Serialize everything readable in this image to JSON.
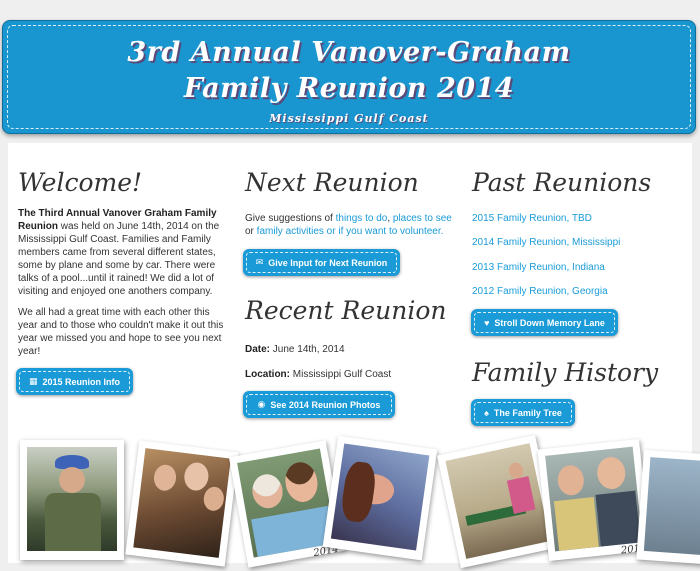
{
  "header": {
    "title_line1": "3rd Annual Vanover-Graham",
    "title_line2": "Family Reunion 2014",
    "subtitle": "Mississippi Gulf Coast"
  },
  "welcome": {
    "heading": "Welcome!",
    "bold_lead": "The Third Annual Vanover Graham Family Reunion",
    "paragraph1_rest": " was held on June 14th, 2014 on the Mississippi Gulf Coast. Families and Family members came from several different states, some by plane and some by car. There were talks of a pool...until it rained! We did a lot of visiting and enjoyed one anothers company.",
    "paragraph2": "We all had a great time with each other this year and to those who couldn't make it out this year we missed you and hope to see you next year!",
    "button": "2015 Reunion Info",
    "button_icon": "calendar-icon"
  },
  "next_reunion": {
    "heading": "Next Reunion",
    "text_a": "Give suggestions of ",
    "link_things": "things to do",
    "text_b": ", ",
    "link_places": "places to see",
    "text_c": " or ",
    "link_activities": "family activities or if you want to volunteer.",
    "button": "Give Input for Next Reunion",
    "button_icon": "envelope-icon"
  },
  "recent_reunion": {
    "heading": "Recent Reunion",
    "date_label": "Date:",
    "date_value": " June 14th, 2014",
    "location_label": "Location:",
    "location_value": " Mississippi Gulf Coast",
    "button": "See 2014 Reunion Photos",
    "button_icon": "camera-icon"
  },
  "past_reunions": {
    "heading": "Past Reunions",
    "links": [
      "2015 Family Reunion, TBD",
      "2014 Family Reunion, Mississippi",
      "2013 Family Reunion, Indiana",
      "2012 Family Reunion, Georgia"
    ],
    "button": "Stroll Down Memory Lane",
    "button_icon": "heart-icon"
  },
  "family_history": {
    "heading": "Family History",
    "button": "The Family Tree",
    "button_icon": "tree-icon"
  },
  "photos": {
    "caption_1": "2014",
    "caption_2": "2014"
  },
  "colors": {
    "brand_blue": "#1a9bd7",
    "banner_blue": "#1996cf"
  }
}
